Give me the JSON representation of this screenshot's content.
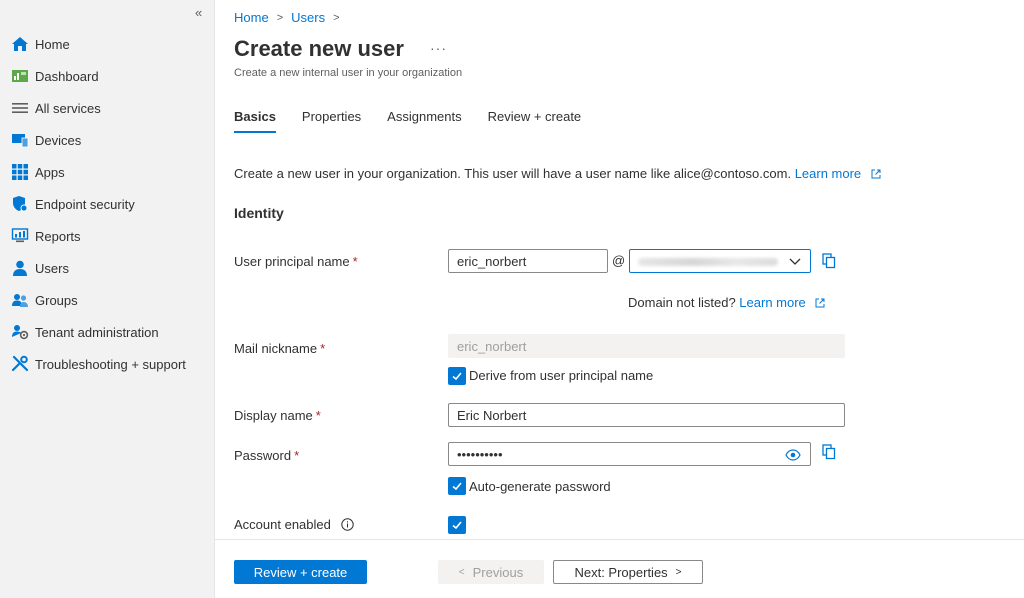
{
  "sidebar": {
    "collapse_glyph": "«",
    "items": [
      {
        "label": "Home",
        "icon": "home-icon"
      },
      {
        "label": "Dashboard",
        "icon": "dashboard-icon"
      },
      {
        "label": "All services",
        "icon": "list-icon"
      },
      {
        "label": "Devices",
        "icon": "devices-icon"
      },
      {
        "label": "Apps",
        "icon": "apps-icon"
      },
      {
        "label": "Endpoint security",
        "icon": "shield-icon"
      },
      {
        "label": "Reports",
        "icon": "reports-icon"
      },
      {
        "label": "Users",
        "icon": "user-icon"
      },
      {
        "label": "Groups",
        "icon": "groups-icon"
      },
      {
        "label": "Tenant administration",
        "icon": "tenant-admin-icon"
      },
      {
        "label": "Troubleshooting + support",
        "icon": "wrench-icon"
      }
    ]
  },
  "breadcrumb": {
    "home": "Home",
    "users": "Users",
    "sep": ">"
  },
  "header": {
    "title": "Create new user",
    "more": "···",
    "subtitle": "Create a new internal user in your organization"
  },
  "tabs": [
    {
      "label": "Basics",
      "active": true
    },
    {
      "label": "Properties",
      "active": false
    },
    {
      "label": "Assignments",
      "active": false
    },
    {
      "label": "Review + create",
      "active": false
    }
  ],
  "intro": {
    "text": "Create a new user in your organization. This user will have a user name like alice@contoso.com.",
    "link": "Learn more"
  },
  "identity": {
    "heading": "Identity",
    "upn_label": "User principal name",
    "upn_value": "eric_norbert",
    "at": "@",
    "domain_note": "Domain not listed?",
    "domain_link": "Learn more",
    "mail_label": "Mail nickname",
    "mail_value": "eric_norbert",
    "derive_label": "Derive from user principal name",
    "display_label": "Display name",
    "display_value": "Eric Norbert",
    "password_label": "Password",
    "password_value": "••••••••••",
    "autogen_label": "Auto-generate password",
    "enabled_label": "Account enabled",
    "required_mark": "*"
  },
  "footer": {
    "review": "Review + create",
    "previous": "Previous",
    "next": "Next: Properties"
  },
  "colors": {
    "accent": "#0078d4",
    "required": "#a4262c",
    "sidebar_bg": "#f2f2f2"
  }
}
